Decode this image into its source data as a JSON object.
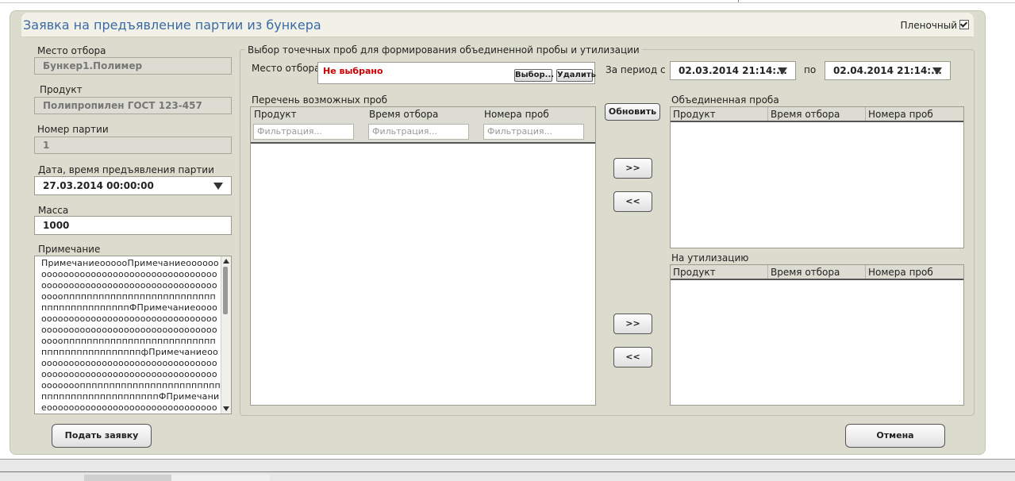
{
  "window": {
    "title": "Заявка на предъявление партии из бункера",
    "film_label": "Пленочный",
    "film_checked": true
  },
  "left": {
    "place_label": "Место отбора",
    "place_value": "Бункер1.Полимер",
    "product_label": "Продукт",
    "product_value": "Полипропилен ГОСТ 123-457",
    "batch_label": "Номер партии",
    "batch_value": "1",
    "date_label": "Дата, время предъявления партии",
    "date_value": "27.03.2014  00:00:00",
    "mass_label": "Масса",
    "mass_value": "1000",
    "note_label": "Примечание",
    "note_value": "ПримечаниеоооооПримечаниеоооооооооооооооооооооооооооооооооооооооооооооооооооооооооооооооооооооооооопппппппппппппппппппппппппппппппппппппппппФПримечаниеоооооооооооооооооооооооооооооооооооооооооооооооооооооооооооооооооооооооопппппппппппппппппппппппппппппппппппппппппппфПримечаниеоооооооооооооооооооооооооооооооооооооооооооооооооооооооооооооооооооооооооппппппппппппппппппппппппппппппппппппппппппппФПримечаниеоооооооооооооооооооооооооооооооооооооооооо"
  },
  "selection": {
    "legend": "Выбор точечных проб для формирования объединенной пробы и утилизации",
    "place_label": "Место отбора",
    "place_value": "Не выбрано",
    "choose_btn": "Выбор...",
    "delete_btn": "Удалить",
    "period_label": "За период с",
    "period_from": "02.03.2014  21:14:...",
    "period_to_label": "по",
    "period_to": "02.04.2014  21:14:...",
    "refresh_btn": "Обновить",
    "available_title": "Перечень возможных проб",
    "columns": [
      "Продукт",
      "Время отбора",
      "Номера проб"
    ],
    "filter_placeholder": "Фильтрация...",
    "combined_title": "Объединенная проба",
    "disposal_title": "На утилизацию",
    "move_right": ">>",
    "move_left": "<<"
  },
  "footer": {
    "submit_btn": "Подать заявку",
    "cancel_btn": "Отмена"
  },
  "colors": {
    "title": "#3b6aa6",
    "panel": "#dcdcce",
    "not_selected": "#cc0000"
  }
}
